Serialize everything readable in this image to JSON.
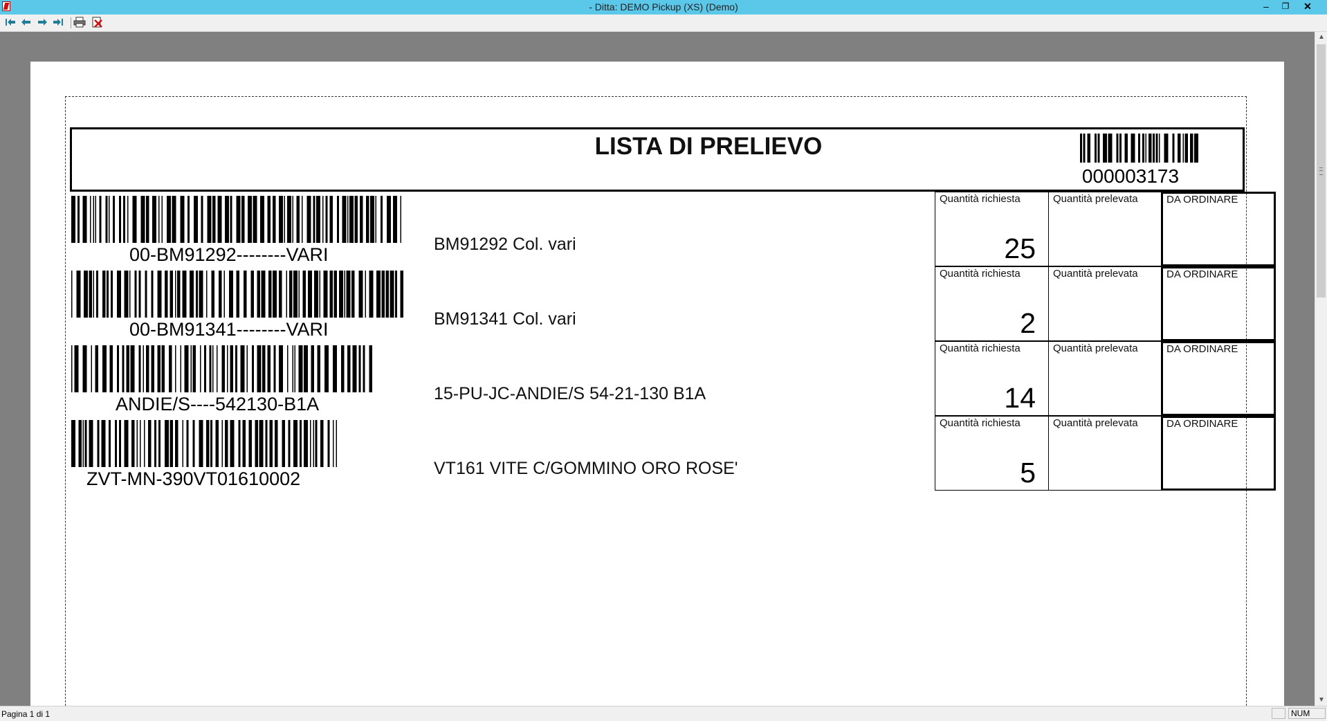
{
  "window": {
    "title": "- Ditta: DEMO Pickup (XS)  (Demo)",
    "minimize_glyph": "‒",
    "restore_glyph": "❐",
    "close_glyph": "✕"
  },
  "toolbar": {
    "buttons": [
      "first-page-icon",
      "previous-page-icon",
      "next-page-icon",
      "last-page-icon",
      "print-icon",
      "close-preview-icon"
    ]
  },
  "document": {
    "title": "LISTA DI PRELIEVO",
    "number": "000003173",
    "labels": {
      "qty_requested": "Quantità richiesta",
      "qty_picked": "Quantità prelevata",
      "to_order": "DA ORDINARE"
    },
    "items": [
      {
        "code": "00-BM91292--------VARI",
        "description": "BM91292 Col. vari",
        "qty_requested": "25"
      },
      {
        "code": "00-BM91341--------VARI",
        "description": "BM91341 Col. vari",
        "qty_requested": "2"
      },
      {
        "code": "ANDIE/S----542130-B1A",
        "description": "15-PU-JC-ANDIE/S 54-21-130 B1A",
        "qty_requested": "14"
      },
      {
        "code": "ZVT-MN-390VT01610002",
        "description": "VT161 VITE C/GOMMINO ORO ROSE'",
        "qty_requested": "5"
      }
    ]
  },
  "status": {
    "page": "Pagina 1 di 1",
    "num": "NUM"
  }
}
